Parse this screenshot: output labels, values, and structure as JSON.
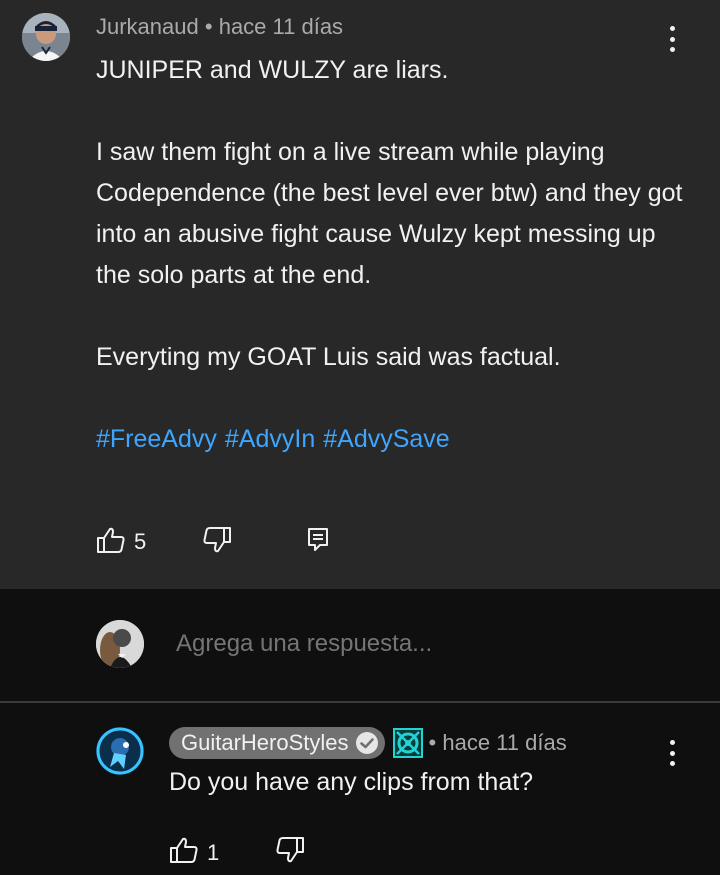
{
  "comment": {
    "author": "Jurkanaud",
    "time": "hace 11 días",
    "paragraphs": [
      "JUNIPER and WULZY are liars.",
      "I saw them fight on a live stream while playing Codependence (the best level ever btw) and they got into an abusive fight cause Wulzy kept messing up the solo parts at the end.",
      "Everyting my GOAT Luis said was factual."
    ],
    "hashtags": [
      "#FreeAdvy",
      "#AdvyIn",
      "#AdvySave"
    ],
    "like_count": "5"
  },
  "reply_input": {
    "placeholder": "Agrega una respuesta..."
  },
  "reply": {
    "author": "GuitarHeroStyles",
    "time": "hace 11 días",
    "text": "Do you have any clips from that?",
    "like_count": "1"
  },
  "colors": {
    "comment_bg": "#282828",
    "page_bg": "#0f0f0f",
    "hashtag": "#3ea6ff",
    "chip": "#717171"
  },
  "icons": {
    "like": "thumbs-up-icon",
    "dislike": "thumbs-down-icon",
    "reply": "reply-comment-icon",
    "menu": "more-vertical-icon",
    "verified": "verified-check-icon",
    "member": "member-badge-icon"
  }
}
